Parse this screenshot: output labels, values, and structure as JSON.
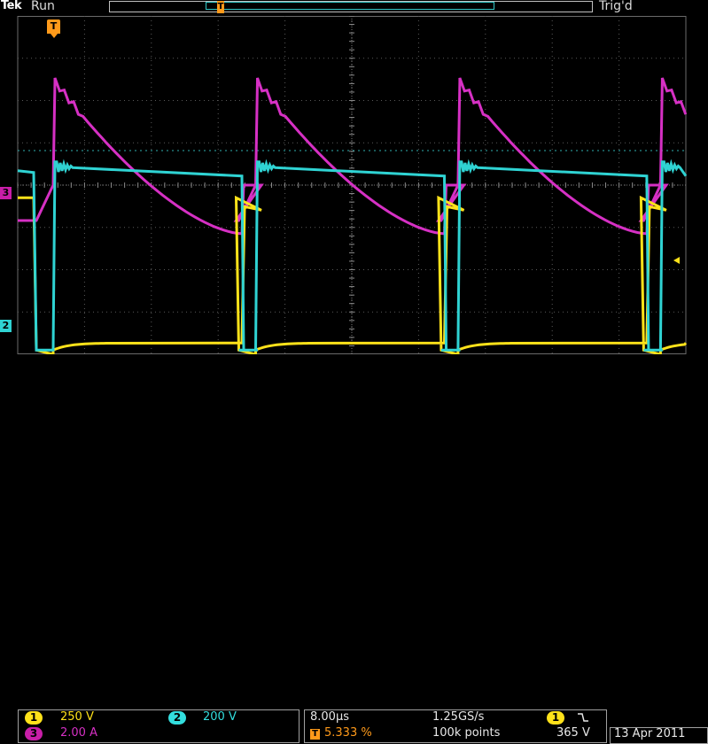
{
  "header": {
    "brand": "Tek",
    "run_state": "Run",
    "trigger_state": "Trig'd"
  },
  "markers": {
    "trigger_position": "T",
    "ch3": "3",
    "ch2": "2"
  },
  "channels": [
    {
      "id": "1",
      "scale": "250 V",
      "color": "#ffe21a"
    },
    {
      "id": "2",
      "scale": "200 V",
      "color": "#33dede"
    },
    {
      "id": "3",
      "scale": "2.00 A",
      "color": "#d630c4"
    }
  ],
  "timebase": {
    "horizontal_scale": "8.00µs",
    "sample_rate": "1.25GS/s",
    "trigger_position": "5.333 %",
    "record_length": "100k points"
  },
  "trigger": {
    "source": "1",
    "slope_icon": "falling-edge-icon",
    "level": "365 V"
  },
  "date": "13 Apr 2011",
  "chart_data": {
    "type": "line",
    "title": "",
    "x_divisions": 10,
    "y_divisions": 8,
    "grid": true,
    "period_divisions": 3.03,
    "series": [
      {
        "channel": "1",
        "color": "#ffe21a",
        "shape": "square-wave low portion with decaying edge",
        "low_level_div": -3.9,
        "high_level_div": -0.3
      },
      {
        "channel": "2",
        "color": "#33dede",
        "shape": "square wave with ringing",
        "low_level_div": -3.9,
        "high_level_div": 0.3
      },
      {
        "channel": "3",
        "color": "#d630c4",
        "shape": "decaying current ramp",
        "peak_div": 2.45,
        "valley_div": -1.15,
        "baseline_div": 0.0
      }
    ]
  }
}
